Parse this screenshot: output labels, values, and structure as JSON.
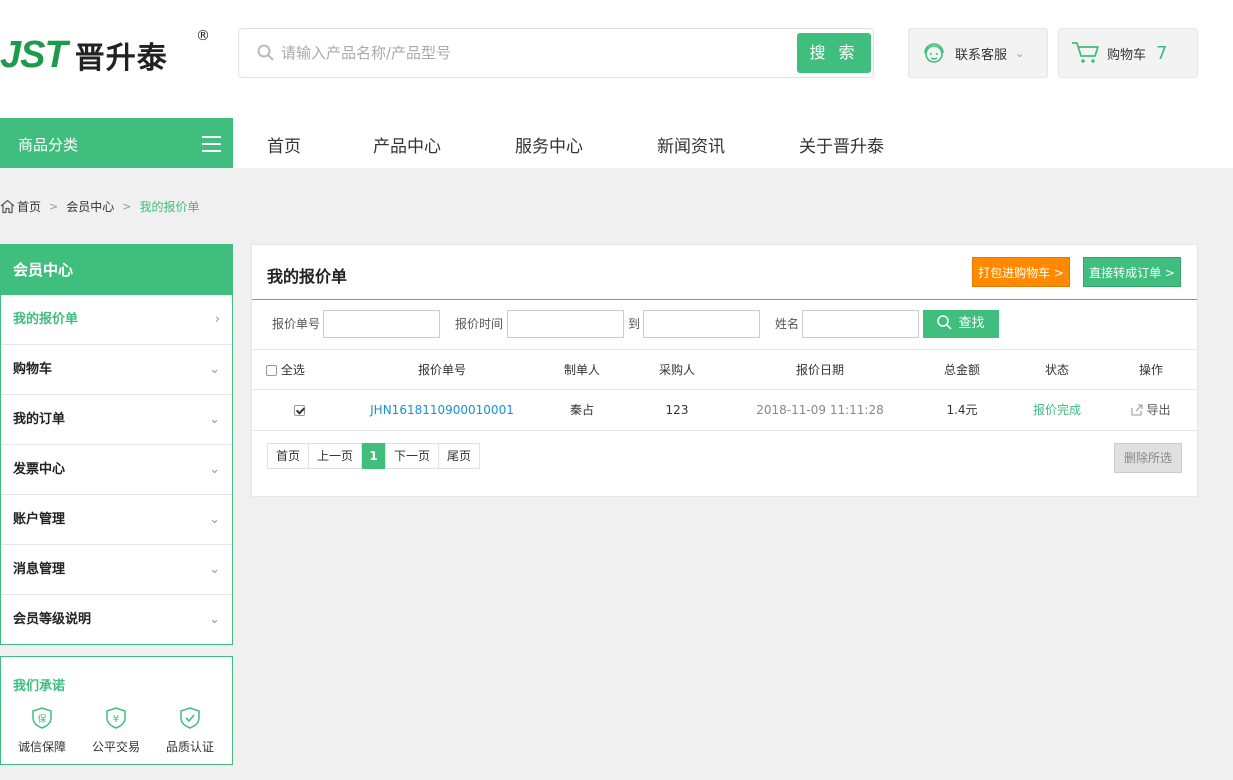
{
  "header": {
    "logo_text": "JST",
    "logo_cn": "晋升泰",
    "logo_reg": "®",
    "search_placeholder": "请输入产品名称/产品型号",
    "search_button": "搜 索",
    "service_label": "联系客服",
    "cart_label": "购物车",
    "cart_count": "7"
  },
  "nav": {
    "category_label": "商品分类",
    "items": [
      "首页",
      "产品中心",
      "服务中心",
      "新闻资讯",
      "关于晋升泰"
    ]
  },
  "breadcrumb": [
    "首页",
    "会员中心",
    "我的报价单"
  ],
  "sidebar": {
    "title": "会员中心",
    "items": [
      "我的报价单",
      "购物车",
      "我的订单",
      "发票中心",
      "账户管理",
      "消息管理",
      "会员等级说明"
    ],
    "active_index": 0
  },
  "promise": {
    "title": "我们承诺",
    "items": [
      {
        "icon": "shield-bao-icon",
        "label": "诚信保障"
      },
      {
        "icon": "shield-yen-icon",
        "label": "公平交易"
      },
      {
        "icon": "shield-check-icon",
        "label": "品质认证"
      }
    ]
  },
  "main": {
    "title": "我的报价单",
    "pack_button": "打包进购物车 >",
    "convert_button": "直接转成订单 >",
    "filters": {
      "quote_no_label": "报价单号",
      "quote_time_label": "报价时间",
      "to_label": "到",
      "name_label": "姓名",
      "query_button": "查找"
    },
    "table": {
      "select_all": "全选",
      "columns": [
        "报价单号",
        "制单人",
        "采购人",
        "报价日期",
        "总金额",
        "状态",
        "操作"
      ],
      "rows": [
        {
          "quote_no": "JHN1618110900010001",
          "maker": "秦占",
          "buyer": "123",
          "date": "2018-11-09  11:11:28",
          "total": "1.4元",
          "status": "报价完成",
          "action": "导出",
          "checked": true
        }
      ]
    },
    "pagination": {
      "first": "首页",
      "prev": "上一页",
      "current": "1",
      "next": "下一页",
      "last": "尾页"
    },
    "delete_button": "删除所选"
  },
  "colors": {
    "brand": "#3fbe7d",
    "orange": "#ff8a00",
    "link": "#1a8fd6"
  }
}
